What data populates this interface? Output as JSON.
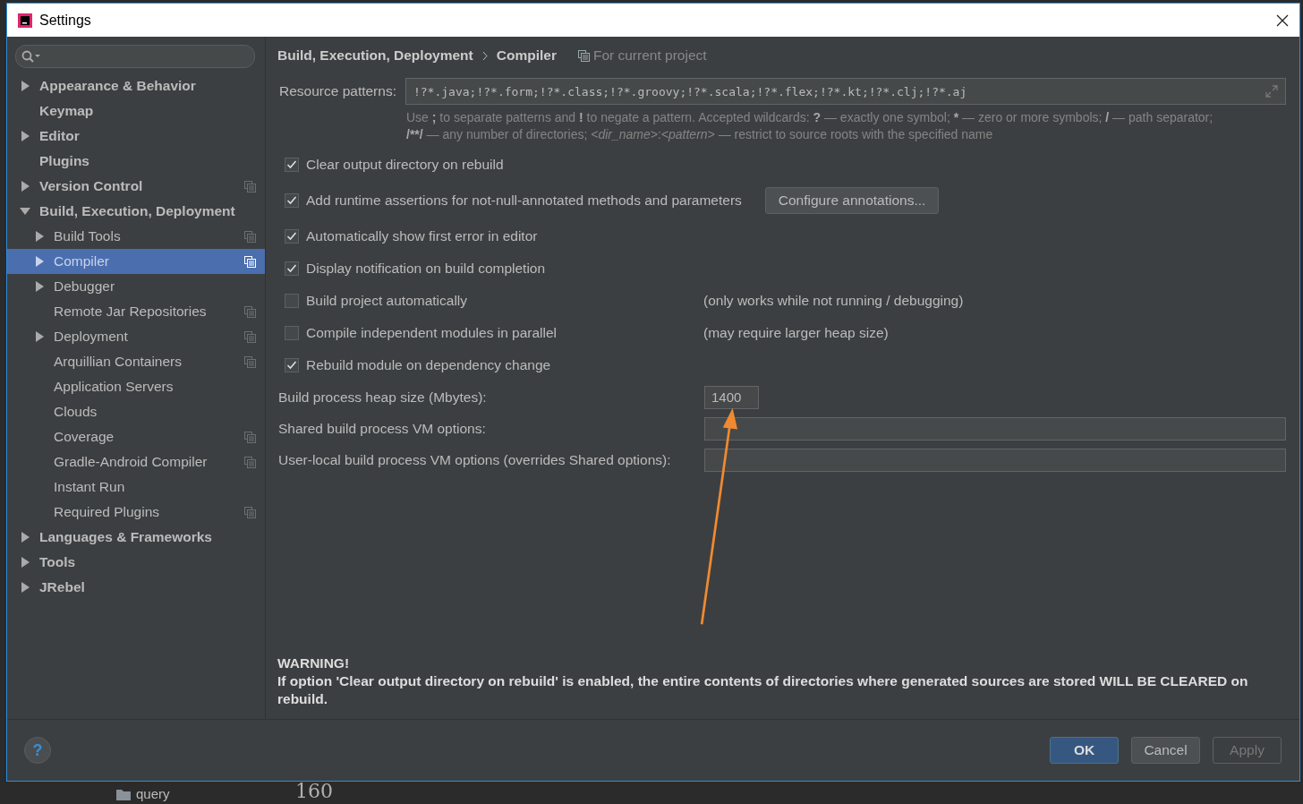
{
  "background": {
    "line_number": "160",
    "tree_item": "query"
  },
  "window": {
    "title": "Settings"
  },
  "sidebar": {
    "items": [
      {
        "label": "Appearance & Behavior",
        "expanded": false,
        "project_scope": false,
        "selected": false
      },
      {
        "label": "Keymap",
        "project_scope": false,
        "selected": false
      },
      {
        "label": "Editor",
        "expanded": false,
        "project_scope": false,
        "selected": false
      },
      {
        "label": "Plugins",
        "project_scope": false,
        "selected": false
      },
      {
        "label": "Version Control",
        "expanded": false,
        "project_scope": true,
        "selected": false
      },
      {
        "label": "Build, Execution, Deployment",
        "expanded": true,
        "project_scope": false,
        "selected": false,
        "children": [
          {
            "label": "Build Tools",
            "expanded": false,
            "project_scope": true,
            "selected": false
          },
          {
            "label": "Compiler",
            "expanded": false,
            "project_scope": true,
            "selected": true
          },
          {
            "label": "Debugger",
            "expanded": false,
            "project_scope": false,
            "selected": false
          },
          {
            "label": "Remote Jar Repositories",
            "project_scope": true,
            "selected": false
          },
          {
            "label": "Deployment",
            "expanded": false,
            "project_scope": true,
            "selected": false
          },
          {
            "label": "Arquillian Containers",
            "project_scope": true,
            "selected": false
          },
          {
            "label": "Application Servers",
            "project_scope": false,
            "selected": false
          },
          {
            "label": "Clouds",
            "project_scope": false,
            "selected": false
          },
          {
            "label": "Coverage",
            "project_scope": true,
            "selected": false
          },
          {
            "label": "Gradle-Android Compiler",
            "project_scope": true,
            "selected": false
          },
          {
            "label": "Instant Run",
            "project_scope": false,
            "selected": false
          },
          {
            "label": "Required Plugins",
            "project_scope": true,
            "selected": false
          }
        ]
      },
      {
        "label": "Languages & Frameworks",
        "expanded": false,
        "project_scope": false,
        "selected": false
      },
      {
        "label": "Tools",
        "expanded": false,
        "project_scope": false,
        "selected": false
      },
      {
        "label": "JRebel",
        "expanded": false,
        "project_scope": false,
        "selected": false
      }
    ]
  },
  "breadcrumb": [
    "Build, Execution, Deployment",
    "Compiler"
  ],
  "scope": "For current project",
  "resource_patterns": {
    "label": "Resource patterns:",
    "value": "!?*.java;!?*.form;!?*.class;!?*.groovy;!?*.scala;!?*.flex;!?*.kt;!?*.clj;!?*.aj",
    "hint": [
      [
        {
          "text": "Use "
        },
        {
          "text": ";",
          "bold": true
        },
        {
          "text": " to separate patterns and "
        },
        {
          "text": "!",
          "bold": true
        },
        {
          "text": " to negate a pattern. Accepted wildcards: "
        },
        {
          "text": "?",
          "bold": true
        },
        {
          "text": " — exactly one symbol; "
        },
        {
          "text": "*",
          "bold": true
        },
        {
          "text": " — zero or more symbols; "
        },
        {
          "text": "/",
          "bold": true
        },
        {
          "text": " — path separator;"
        }
      ],
      [
        {
          "text": "/**/",
          "bold": true
        },
        {
          "text": " — any number of directories; "
        },
        {
          "text": "<dir_name>",
          "italic": true
        },
        {
          "text": ":"
        },
        {
          "text": "<pattern>",
          "italic": true
        },
        {
          "text": " — restrict to source roots with the specified name"
        }
      ]
    ]
  },
  "options": [
    {
      "label": "Clear output directory on rebuild",
      "checked": true
    },
    {
      "label": "Add runtime assertions for not-null-annotated methods and parameters",
      "checked": true,
      "button": "Configure annotations..."
    },
    {
      "label": "Automatically show first error in editor",
      "checked": true
    },
    {
      "label": "Display notification on build completion",
      "checked": true
    },
    {
      "label": "Build project automatically",
      "checked": false,
      "note": "(only works while not running / debugging)"
    },
    {
      "label": "Compile independent modules in parallel",
      "checked": false,
      "note": "(may require larger heap size)"
    },
    {
      "label": "Rebuild module on dependency change",
      "checked": true
    }
  ],
  "fields": [
    {
      "kind": "short",
      "label": "Build process heap size (Mbytes):",
      "value": "1400"
    },
    {
      "kind": "wide",
      "label": "Shared build process VM options:"
    },
    {
      "kind": "wide",
      "label": "User-local build process VM options (overrides Shared options):"
    }
  ],
  "warning": {
    "title": "WARNING!",
    "text": "If option 'Clear output directory on rebuild' is enabled, the entire contents of directories where generated sources are stored WILL BE CLEARED on rebuild."
  },
  "help": "?",
  "buttons": [
    {
      "label": "OK",
      "kind": "default"
    },
    {
      "label": "Cancel",
      "kind": "normal"
    },
    {
      "label": "Apply",
      "kind": "disabled"
    }
  ]
}
